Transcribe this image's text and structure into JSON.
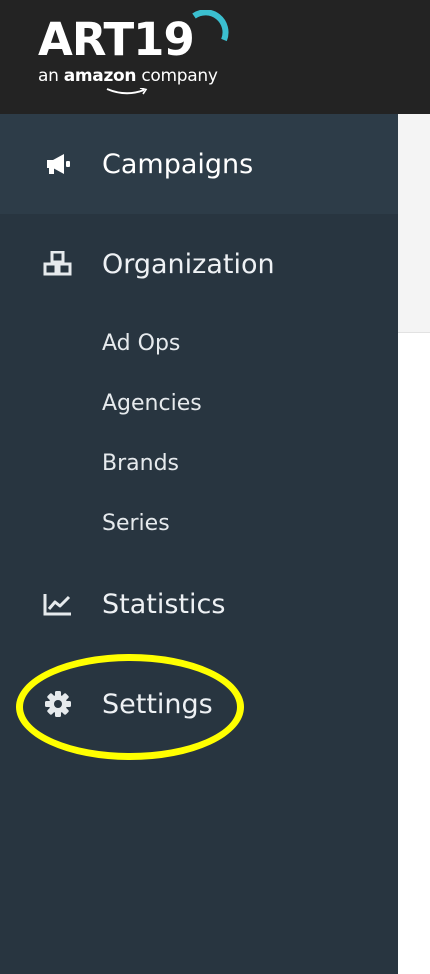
{
  "header": {
    "logo_text": "ART19",
    "logo_tagline_prefix": "an ",
    "logo_tagline_brand": "amazon",
    "logo_tagline_suffix": " company"
  },
  "sidebar": {
    "items": [
      {
        "label": "Campaigns",
        "icon": "megaphone-icon",
        "active": true
      },
      {
        "label": "Organization",
        "icon": "cubes-icon",
        "active": false
      },
      {
        "label": "Statistics",
        "icon": "chart-line-icon",
        "active": false
      },
      {
        "label": "Settings",
        "icon": "gear-icon",
        "active": false
      }
    ],
    "organization_subitems": [
      "Ad Ops",
      "Agencies",
      "Brands",
      "Series"
    ]
  },
  "colors": {
    "topbar": "#232323",
    "sidebar": "#283540",
    "sidebar_active": "#2d3c48",
    "accent": "#3bbfcf",
    "highlight": "#ffff00"
  }
}
